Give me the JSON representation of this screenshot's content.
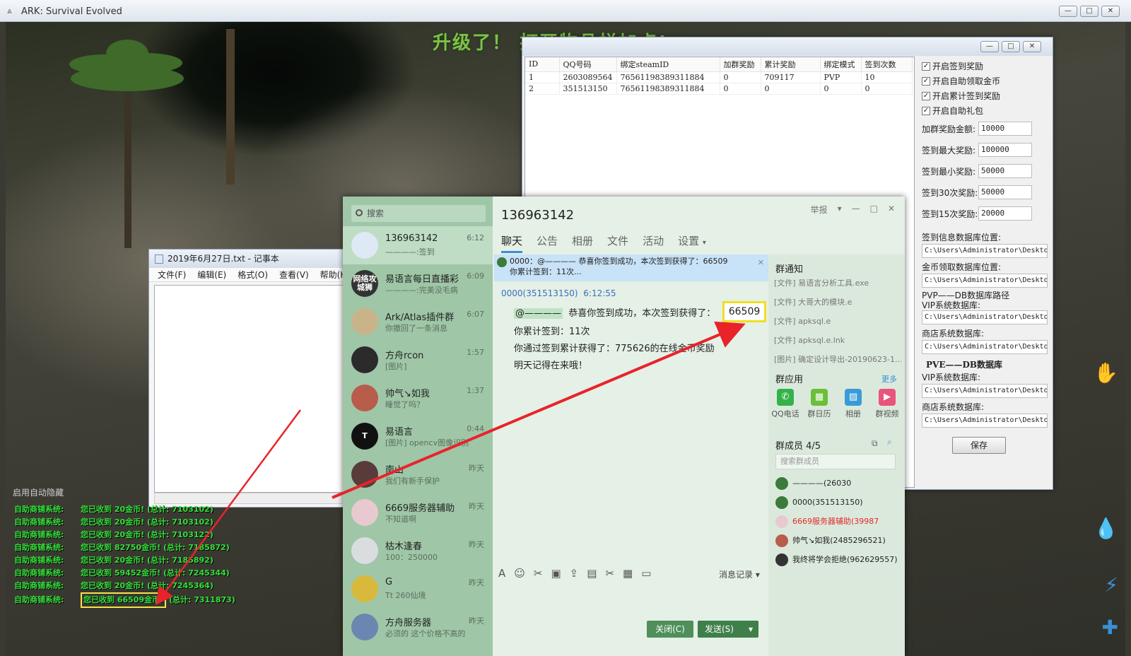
{
  "outer_window": {
    "title": "ARK: Survival Evolved",
    "buttons": [
      "—",
      "□",
      "✕"
    ]
  },
  "game": {
    "banner": "升级了！ 打开物品栏加点!",
    "log_title": "启用自动隐藏",
    "log_rows": [
      {
        "sys": "自助商铺系统:",
        "msg": "您已收到  20金币! (总计: 7103102)"
      },
      {
        "sys": "自助商铺系统:",
        "msg": "您已收到  20金币! (总计: 7103102)"
      },
      {
        "sys": "自助商铺系统:",
        "msg": "您已收到  20金币! (总计: 7103122)"
      },
      {
        "sys": "自助商铺系统:",
        "msg": "您已收到  82750金币! (总计: 7185872)"
      },
      {
        "sys": "自助商铺系统:",
        "msg": "您已收到  20金币! (总计: 7185892)"
      },
      {
        "sys": "自助商铺系统:",
        "msg": "您已收到  59452金币! (总计: 7245344)"
      },
      {
        "sys": "自助商铺系统:",
        "msg": "您已收到  20金币! (总计: 7245364)"
      }
    ],
    "log_last": {
      "sys": "自助商铺系统:",
      "highlight": "您已收到  66509金币!",
      "rest": "(总计: 7311873)"
    }
  },
  "admin": {
    "buttons": [
      "—",
      "□",
      "✕"
    ],
    "columns": [
      "ID",
      "QQ号码",
      "绑定steamID",
      "加群奖励",
      "累计奖励",
      "绑定模式",
      "签到次数"
    ],
    "rows": [
      [
        "1",
        "2603089564",
        "76561198389311884",
        "0",
        "709117",
        "PVP",
        "10"
      ],
      [
        "2",
        "351513150",
        "76561198389311884",
        "0",
        "0",
        "0",
        "0"
      ]
    ],
    "checkboxes": [
      "开启签到奖励",
      "开启自助领取金币",
      "开启累计签到奖励",
      "开启自助礼包"
    ],
    "fields": [
      {
        "label": "加群奖励金额:",
        "value": "10000"
      },
      {
        "label": "签到最大奖励:",
        "value": "100000"
      },
      {
        "label": "签到最小奖励:",
        "value": "50000"
      },
      {
        "label": "签到30次奖励:",
        "value": "50000"
      },
      {
        "label": "签到15次奖励:",
        "value": "20000"
      }
    ],
    "paths": [
      {
        "label": "签到信息数据库位置:",
        "value": "C:\\Users\\Administrator\\Desktop"
      },
      {
        "label": "金币领取数据库位置:",
        "value": "C:\\Users\\Administrator\\Desktop"
      },
      {
        "label": "PVP——DB数据库路径",
        "sub": "VIP系统数据库:",
        "value": "C:\\Users\\Administrator\\Desktop"
      },
      {
        "label": "商店系统数据库:",
        "value": "C:\\Users\\Administrator\\Desktop"
      }
    ],
    "pve_title": "PVE——DB数据库",
    "pve_paths": [
      {
        "label": "VIP系统数据库:",
        "value": "C:\\Users\\Administrator\\Desktop"
      },
      {
        "label": "商店系统数据库:",
        "value": "C:\\Users\\Administrator\\Desktop"
      }
    ],
    "save": "保存"
  },
  "notepad": {
    "title": "2019年6月27日.txt - 记事本",
    "menu": [
      "文件(F)",
      "编辑(E)",
      "格式(O)",
      "查看(V)",
      "帮助(H)"
    ]
  },
  "qq": {
    "search_placeholder": "搜索",
    "conversations": [
      {
        "name": "136963142",
        "preview": "————:签到",
        "time": "6:12",
        "avatar": "",
        "color": "#dfe9f5"
      },
      {
        "name": "易语言每日直播彩",
        "preview": "————:完美没毛病",
        "time": "6:09",
        "avatar": "网络攻城狮",
        "color": "#333333"
      },
      {
        "name": "Ark/Atlas插件群",
        "preview": "你撤回了一条消息",
        "time": "6:07",
        "avatar": "",
        "color": "#c9b48a"
      },
      {
        "name": "方舟rcon",
        "preview": "[图片]",
        "time": "1:57",
        "avatar": "",
        "color": "#2b2b2b"
      },
      {
        "name": "帅气↘如我",
        "preview": "睡觉了吗？",
        "time": "1:37",
        "avatar": "",
        "color": "#b85c4c"
      },
      {
        "name": "易语言",
        "preview": "[图片] opencv图像识别模",
        "time": "0:44",
        "avatar": "T",
        "color": "#111111"
      },
      {
        "name": "南山",
        "preview": "我们有新手保护",
        "time": "昨天",
        "avatar": "",
        "color": "#5a3b3b"
      },
      {
        "name": "6669服务器辅助",
        "preview": "不知道啊",
        "time": "昨天",
        "avatar": "",
        "color": "#e8c9cf"
      },
      {
        "name": "枯木逢春",
        "preview": "100：250000",
        "time": "昨天",
        "avatar": "",
        "color": "#d9dde0"
      },
      {
        "name": "G",
        "preview": "Tt  260仙境",
        "time": "昨天",
        "avatar": "",
        "color": "#d8b93c"
      },
      {
        "name": "方舟服务器",
        "preview": "必须的 这个价格不高的",
        "time": "昨天",
        "avatar": "",
        "color": "#6b86b0"
      }
    ],
    "chat_title": "136963142",
    "top_ctrl": [
      "举报",
      "▾",
      "—",
      "□",
      "✕"
    ],
    "tabs": [
      "聊天",
      "公告",
      "相册",
      "文件",
      "活动",
      "设置"
    ],
    "pinned": {
      "line1": "0000：@————  恭喜你签到成功，本次签到获得了：66509",
      "line2": "你累计签到：11次..."
    },
    "sender": "0000(351513150)",
    "sender_time": "6:12:55",
    "msg": {
      "mention": "@————",
      "text1": "恭喜你签到成功，本次签到获得了：",
      "amount": "66509",
      "text2": "你累计签到：11次",
      "text3": "你通过签到累计获得了：775626的在线金币奖励",
      "text4": "明天记得在来哦！"
    },
    "toolbar_icons": [
      "A",
      "☺",
      "✂",
      "▣",
      "⇪",
      "▤",
      "✂",
      "▦",
      "▭"
    ],
    "history": "消息记录",
    "close": "关闭(C)",
    "send": "发送(S)",
    "side": {
      "notice_title": "群通知",
      "notices": [
        "[文件] 易语言分析工具.exe",
        "[文件] 大哥大的模块.e",
        "[文件] apksql.e",
        "[文件] apksql.e.lnk",
        "[图片] 确定设计导出-20190623-1..."
      ],
      "apps_title": "群应用",
      "apps_more": "更多",
      "apps": [
        {
          "label": "QQ电话",
          "color": "#33b24a",
          "glyph": "✆"
        },
        {
          "label": "群日历",
          "color": "#6bbf3a",
          "glyph": "▦"
        },
        {
          "label": "相册",
          "color": "#3a9bd8",
          "glyph": "▨"
        },
        {
          "label": "群视频",
          "color": "#e8557a",
          "glyph": "▶"
        }
      ],
      "members_title": "群成员 4/5",
      "members_search": "搜索群成员",
      "members": [
        {
          "name": "————(26030",
          "color": "#3b7a3b",
          "red": false
        },
        {
          "name": "0000(351513150)",
          "color": "#3b7a3b",
          "red": false
        },
        {
          "name": "6669服务器辅助(39987",
          "color": "#e8c9cf",
          "red": true
        },
        {
          "name": "帅气↘如我(2485296521)",
          "color": "#b85c4c",
          "red": false
        },
        {
          "name": "我终将学会拒绝(962629557)",
          "color": "#333333",
          "red": false
        }
      ]
    }
  }
}
